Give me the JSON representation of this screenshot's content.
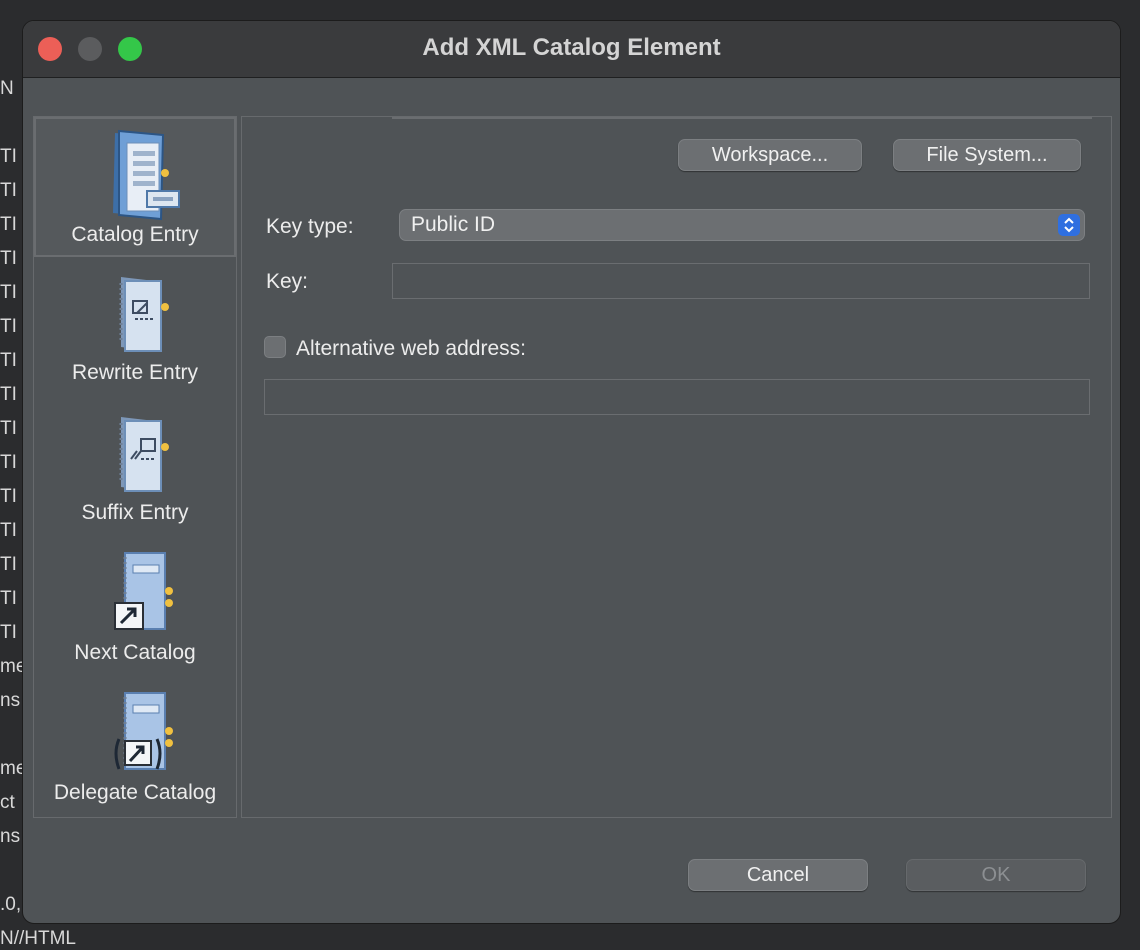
{
  "dialog": {
    "title": "Add XML Catalog Element"
  },
  "background_text": [
    "N",
    "TI",
    "TI",
    "TI",
    "TI",
    "TI",
    "TI",
    "TI",
    "TI",
    "TI",
    "TI",
    "TI",
    "TI",
    "TI",
    "TI",
    "TI",
    "me",
    "ns",
    "me",
    "ct",
    "ns",
    ".0,",
    "N//HTML"
  ],
  "sidebar": {
    "items": [
      {
        "label": "Catalog Entry",
        "icon": "catalog-entry-icon",
        "selected": true
      },
      {
        "label": "Rewrite Entry",
        "icon": "rewrite-entry-icon",
        "selected": false
      },
      {
        "label": "Suffix Entry",
        "icon": "suffix-entry-icon",
        "selected": false
      },
      {
        "label": "Next Catalog",
        "icon": "next-catalog-icon",
        "selected": false
      },
      {
        "label": "Delegate Catalog",
        "icon": "delegate-catalog-icon",
        "selected": false
      }
    ]
  },
  "main": {
    "workspace_button": "Workspace...",
    "file_system_button": "File System...",
    "key_type_label": "Key type:",
    "key_type_value": "Public ID",
    "key_label": "Key:",
    "key_value": "",
    "alt_web_address_label": "Alternative web address:",
    "alt_web_address_checked": false,
    "alt_web_address_value": ""
  },
  "footer": {
    "cancel_button": "Cancel",
    "ok_button": "OK",
    "ok_enabled": false
  },
  "colors": {
    "dialog_bg": "#4f5356",
    "titlebar_bg": "#3a3b3d",
    "close": "#ec5f57",
    "maximize": "#34c749",
    "stepper_accent": "#2f6fe0"
  }
}
